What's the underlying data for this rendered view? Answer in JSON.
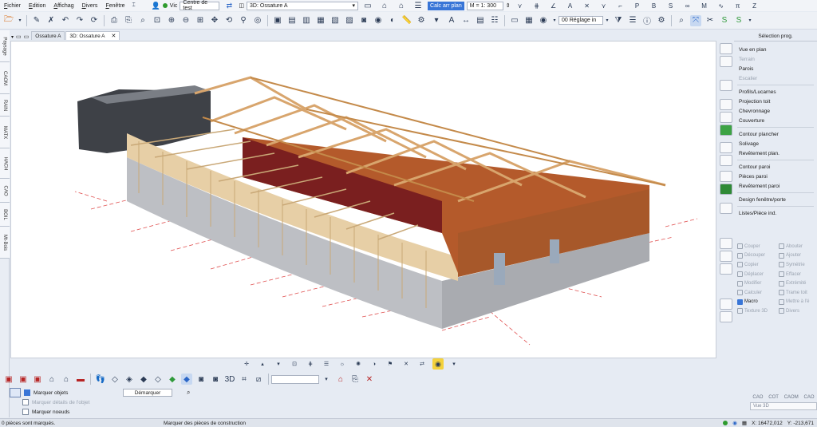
{
  "menu": [
    "Fichier",
    "Edition",
    "Affichag",
    "Divers",
    "Fenêtre"
  ],
  "menubar_right": {
    "vic_label": "Vic",
    "project": "Centre de test",
    "view_select": "3D: Ossature A",
    "calc_btn": "Calc arr plan",
    "scale": "M = 1: 300"
  },
  "toolbar2": {
    "reglage": "00 Réglage in"
  },
  "left_tabs": [
    "Paysage",
    "CAOM",
    "RAIN",
    "MATX",
    "HACH",
    "CAO",
    "BOIL",
    "Mt-Bois"
  ],
  "doc_tabs": [
    {
      "label": "Ossature A",
      "active": false
    },
    {
      "label": "3D: Ossature A",
      "active": true
    }
  ],
  "right_panel": {
    "title": "Sélection prog.",
    "groups": [
      [
        {
          "label": "Vue en plan",
          "enabled": true
        },
        {
          "label": "Terrain",
          "enabled": false
        },
        {
          "label": "Parois",
          "enabled": true
        },
        {
          "label": "Escalier",
          "enabled": false
        }
      ],
      [
        {
          "label": "Profils/Lucarnes",
          "enabled": true
        },
        {
          "label": "Projection toit",
          "enabled": true
        },
        {
          "label": "Chevronnage",
          "enabled": true
        },
        {
          "label": "Couverture",
          "enabled": true
        }
      ],
      [
        {
          "label": "Contour plancher",
          "enabled": true
        },
        {
          "label": "Solivage",
          "enabled": true
        },
        {
          "label": "Revêtement plan.",
          "enabled": true
        }
      ],
      [
        {
          "label": "Contour paroi",
          "enabled": true
        },
        {
          "label": "Pièces paroi",
          "enabled": true
        },
        {
          "label": "Revêtement paroi",
          "enabled": true
        }
      ],
      [
        {
          "label": "Design fenêtre/porte",
          "enabled": true
        }
      ],
      [
        {
          "label": "Listes/Pièce ind.",
          "enabled": true
        }
      ]
    ],
    "actions": [
      {
        "left": "Couper",
        "right": "Abouter",
        "on": false
      },
      {
        "left": "Découper",
        "right": "Ajouter",
        "on": false
      },
      {
        "left": "Copier",
        "right": "Symétrie",
        "on": false
      },
      {
        "left": "Déplacer",
        "right": "Effacer",
        "on": false
      },
      {
        "left": "Modifier",
        "right": "Extrémité",
        "on": false
      },
      {
        "left": "Calculer",
        "right": "Trame toit",
        "on": false
      },
      {
        "left": "Macro",
        "right": "Mettre à l'é",
        "on": true
      },
      {
        "left": "Texture 3D",
        "right": "Divers",
        "on": false
      }
    ]
  },
  "mark_panel": {
    "items": [
      {
        "label": "Marquer objets",
        "enabled": true
      },
      {
        "label": "Marquer détails de l'objet",
        "enabled": false
      },
      {
        "label": "Marquer noeuds",
        "enabled": true
      }
    ],
    "demarquer": "Démarquer"
  },
  "view_list": {
    "buttons": [
      "CAO",
      "COT",
      "CAOM",
      "CAO"
    ],
    "input": "Vue 3D"
  },
  "status": {
    "left": "0 pièces sont marqués.",
    "middle": "Marquer des pièces de construction",
    "x": "X: 16472,012",
    "y": "Y: -213,671"
  }
}
